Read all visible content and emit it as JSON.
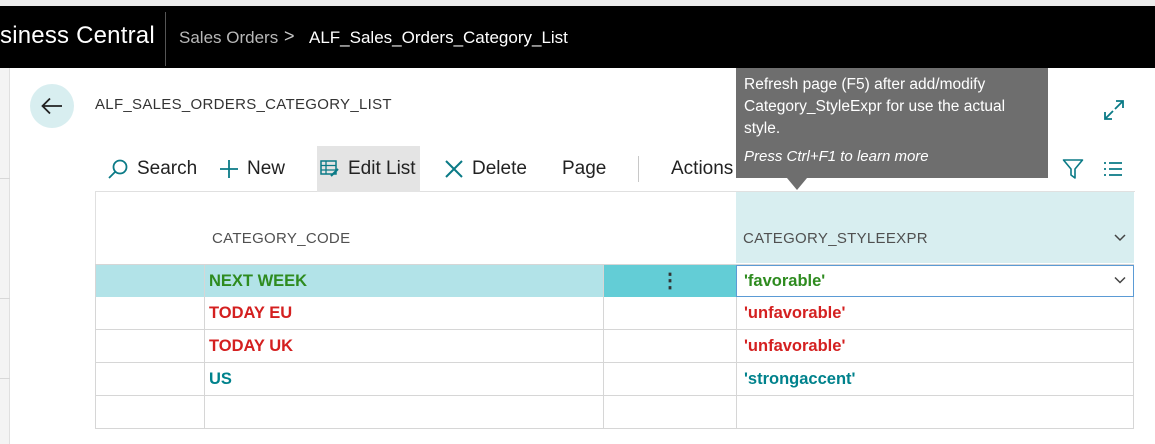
{
  "app": {
    "name": "siness Central"
  },
  "breadcrumb": {
    "parent": "Sales Orders",
    "separator": ">",
    "current": "ALF_Sales_Orders_Category_List"
  },
  "page": {
    "title": "ALF_SALES_ORDERS_CATEGORY_LIST"
  },
  "actions": {
    "search": "Search",
    "new": "New",
    "edit_list": "Edit List",
    "delete": "Delete",
    "page": "Page",
    "actions": "Actions"
  },
  "tooltip": {
    "text": "Refresh page (F5) after add/modify Category_StyleExpr for use the actual style.",
    "hint": "Press Ctrl+F1 to learn more"
  },
  "columns": {
    "code": "CATEGORY_CODE",
    "style": "CATEGORY_STYLEEXPR"
  },
  "colors": {
    "favorable": "#2e7d32",
    "unfavorable": "#d32f2f",
    "strongaccent": "#00838f",
    "accent_light": "#d8eef0",
    "selection": "#b2e3e8"
  },
  "rows": [
    {
      "code": "NEXT WEEK",
      "style": "'favorable'",
      "color": "#2e8b1f"
    },
    {
      "code": "TODAY EU",
      "style": "'unfavorable'",
      "color": "#d42020"
    },
    {
      "code": "TODAY UK",
      "style": "'unfavorable'",
      "color": "#d42020"
    },
    {
      "code": "US",
      "style": "'strongaccent'",
      "color": "#00828c"
    },
    {
      "code": "",
      "style": "",
      "color": "#212121"
    }
  ]
}
